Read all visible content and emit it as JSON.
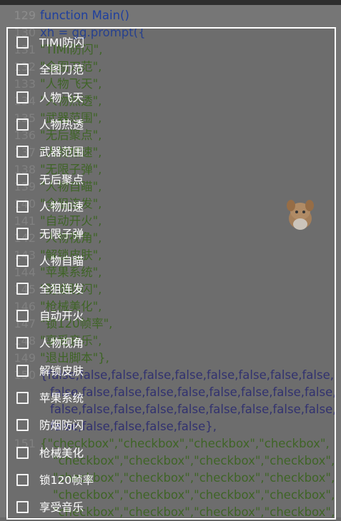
{
  "editor": {
    "lines": [
      {
        "num": "129",
        "text": "function Main()"
      },
      {
        "num": "130",
        "text": "xh = gg.prompt({"
      },
      {
        "num": "131",
        "text": "\"TIMI防闪\","
      },
      {
        "num": "132",
        "text": "\"全图刀范\","
      },
      {
        "num": "133",
        "text": "\"人物飞天\","
      },
      {
        "num": "134",
        "text": "\"人物热透\","
      },
      {
        "num": "135",
        "text": "\"武器范围\","
      },
      {
        "num": "136",
        "text": "\"无后聚点\","
      },
      {
        "num": "137",
        "text": "\"人物加速\","
      },
      {
        "num": "138",
        "text": "\"无限子弹\","
      },
      {
        "num": "139",
        "text": "\"人物自瞄\","
      },
      {
        "num": "140",
        "text": "\"全狙连发\","
      },
      {
        "num": "141",
        "text": "\"自动开火\","
      },
      {
        "num": "142",
        "text": "\"人物视角\","
      },
      {
        "num": "143",
        "text": "\"解锁皮肤\","
      },
      {
        "num": "144",
        "text": "\"苹果系统\","
      },
      {
        "num": "145",
        "text": "\"防烟防闪\","
      },
      {
        "num": "146",
        "text": "\"枪械美化\","
      },
      {
        "num": "147",
        "text": "\"锁120帧率\","
      },
      {
        "num": "148",
        "text": "\"享受音乐\","
      },
      {
        "num": "149",
        "text": "\"退出脚本\"},"
      },
      {
        "num": "150",
        "text": "{false,false,false,false,false,false,false,false,false,"
      },
      {
        "num": "",
        "text": "false,false,false,false,false,false,false,false,false,"
      },
      {
        "num": "",
        "text": "false,false,false,false,false,false,false,false,false,"
      },
      {
        "num": "",
        "text": "false,false,false,false,false},"
      },
      {
        "num": "151",
        "text": "{\"checkbox\",\"checkbox\",\"checkbox\",\"checkbox\","
      },
      {
        "num": "",
        "text": "\"checkbox\",\"checkbox\",\"checkbox\",\"checkbox\","
      },
      {
        "num": "",
        "text": "\"checkbox\",\"checkbox\",\"checkbox\",\"checkbox\","
      },
      {
        "num": "",
        "text": "\"checkbox\",\"checkbox\",\"checkbox\",\"checkbox\","
      },
      {
        "num": "",
        "text": "\"checkbox\",\"checkbox\",\"checkbox\",\"checkbox\","
      }
    ]
  },
  "dialog": {
    "items": [
      {
        "label": "TIMI防闪"
      },
      {
        "label": "全图刀范"
      },
      {
        "label": "人物飞天"
      },
      {
        "label": "人物热透"
      },
      {
        "label": "武器范围"
      },
      {
        "label": "无后聚点"
      },
      {
        "label": "人物加速"
      },
      {
        "label": "无限子弹"
      },
      {
        "label": "人物自瞄"
      },
      {
        "label": "全狙连发"
      },
      {
        "label": "自动开火"
      },
      {
        "label": "人物视角"
      },
      {
        "label": "解锁皮肤"
      },
      {
        "label": "苹果系统"
      },
      {
        "label": "防烟防闪"
      },
      {
        "label": "枪械美化"
      },
      {
        "label": "锁120帧率"
      },
      {
        "label": "享受音乐"
      }
    ]
  },
  "colors": {
    "overlay_border": "#ffffff",
    "code_string": "#3d6b1f",
    "code_keyword": "#1f3f9e"
  }
}
